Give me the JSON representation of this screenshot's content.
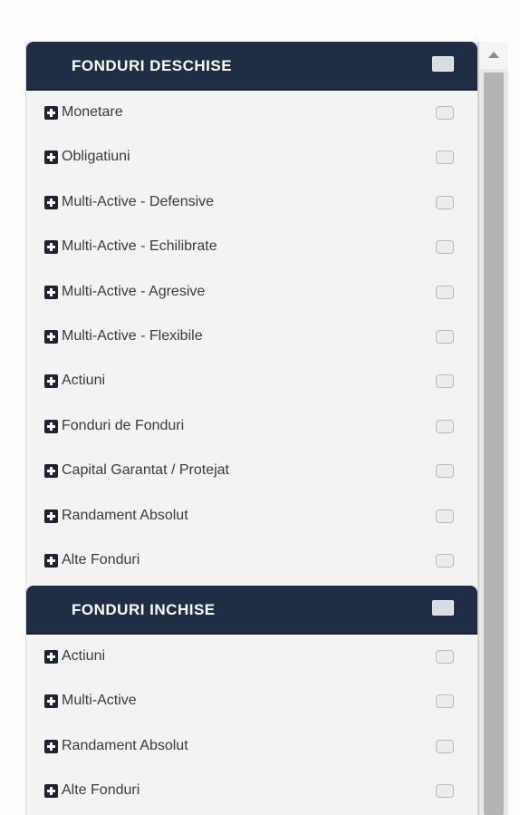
{
  "open_funds": {
    "title": "FONDURI DESCHISE",
    "items": [
      {
        "label": "Monetare"
      },
      {
        "label": "Obligatiuni"
      },
      {
        "label": "Multi-Active - Defensive"
      },
      {
        "label": "Multi-Active - Echilibrate"
      },
      {
        "label": "Multi-Active - Agresive"
      },
      {
        "label": "Multi-Active - Flexibile"
      },
      {
        "label": "Actiuni"
      },
      {
        "label": "Fonduri de Fonduri"
      },
      {
        "label": "Capital Garantat / Protejat"
      },
      {
        "label": "Randament Absolut"
      },
      {
        "label": "Alte Fonduri"
      }
    ]
  },
  "closed_funds": {
    "title": "FONDURI INCHISE",
    "items": [
      {
        "label": "Actiuni"
      },
      {
        "label": "Multi-Active"
      },
      {
        "label": "Randament Absolut"
      },
      {
        "label": "Alte Fonduri"
      }
    ]
  },
  "icons": {
    "expand": "plus-square-icon",
    "scroll_up": "arrow-up-icon"
  },
  "colors": {
    "header_bg": "#1f2d45",
    "header_text": "#ffffff",
    "panel_bg": "#f3f3f3",
    "label_text": "#3a3a3a"
  }
}
